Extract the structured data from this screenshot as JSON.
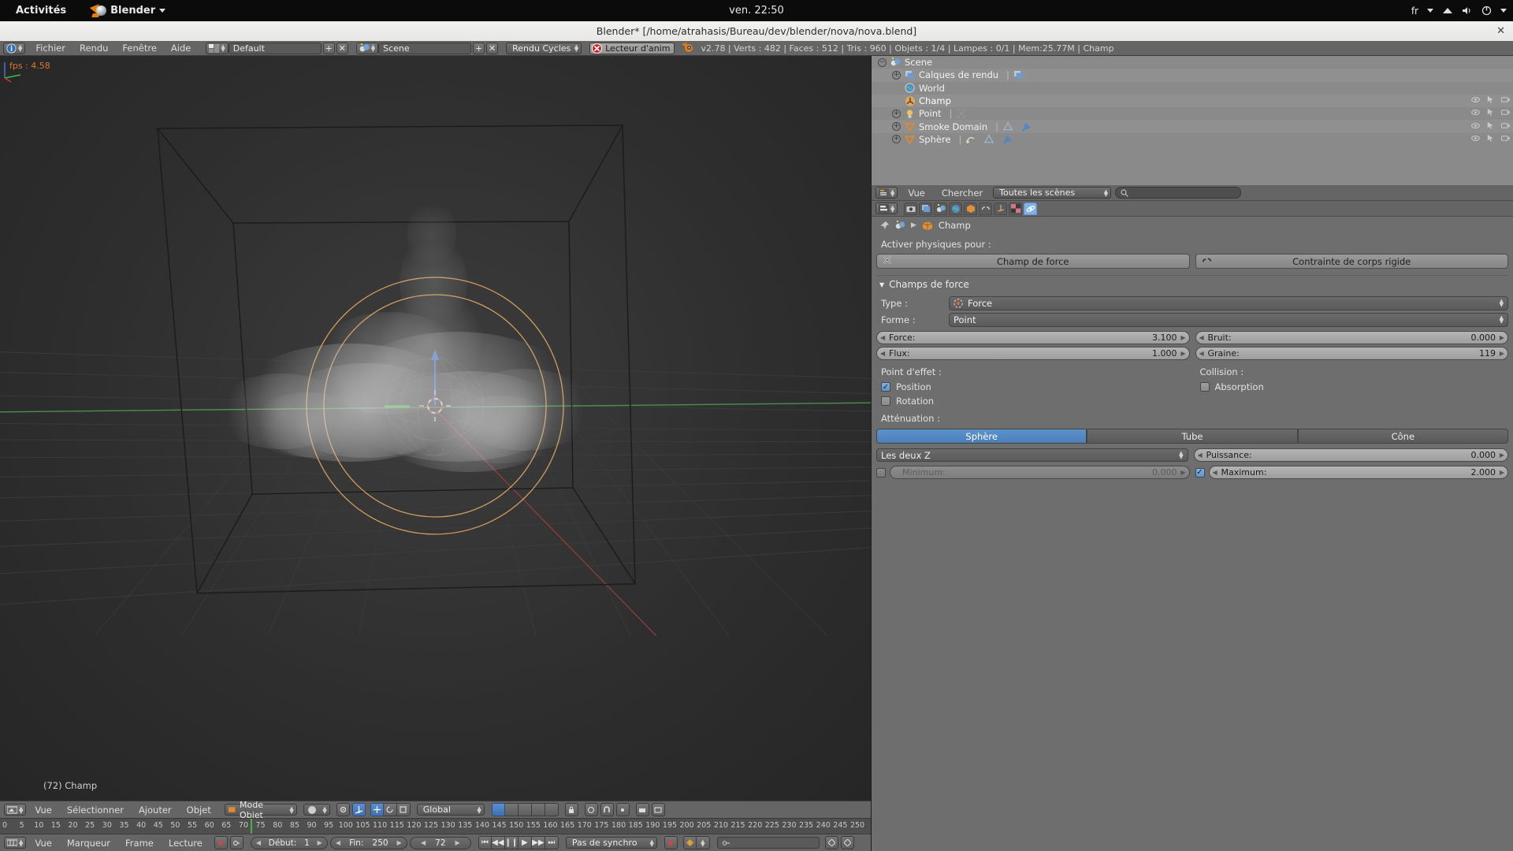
{
  "gnome": {
    "activities": "Activités",
    "app_name": "Blender",
    "clock": "ven. 22:50",
    "lang": "fr"
  },
  "window": {
    "title": "Blender* [/home/atrahasis/Bureau/dev/blender/nova/nova.blend]",
    "close": "✕"
  },
  "info_header": {
    "menus": [
      "Fichier",
      "Rendu",
      "Fenêtre",
      "Aide"
    ],
    "screen_layout": "Default",
    "scene": "Scene",
    "engine": "Rendu Cycles",
    "anim_player": "Lecteur d'anim",
    "stats": "v2.78 | Verts  : 482 | Faces  : 512 | Tris  : 960 | Objets  : 1/4 | Lampes  : 0/1 | Mem:25.77M | Champ",
    "add_label": "+",
    "remove_label": "✕"
  },
  "viewport": {
    "fps": "fps : 4.58",
    "object_label": "(72) Champ",
    "footer_menus": [
      "Vue",
      "Sélectionner",
      "Ajouter",
      "Objet"
    ],
    "mode": "Mode Objet",
    "orientation": "Global"
  },
  "timeline": {
    "menus": [
      "Vue",
      "Marqueur",
      "Frame",
      "Lecture"
    ],
    "start_label": "Début:",
    "start_value": "1",
    "end_label": "Fin:",
    "end_value": "250",
    "current_frame": "72",
    "sync_mode": "Pas de synchro",
    "ticks": [
      {
        "label": "0",
        "frame": 0
      },
      {
        "label": "5",
        "frame": 5
      },
      {
        "label": "10",
        "frame": 10
      },
      {
        "label": "15",
        "frame": 15
      },
      {
        "label": "20",
        "frame": 20
      },
      {
        "label": "25",
        "frame": 25
      },
      {
        "label": "30",
        "frame": 30
      },
      {
        "label": "35",
        "frame": 35
      },
      {
        "label": "40",
        "frame": 40
      },
      {
        "label": "45",
        "frame": 45
      },
      {
        "label": "50",
        "frame": 50
      },
      {
        "label": "55",
        "frame": 55
      },
      {
        "label": "60",
        "frame": 60
      },
      {
        "label": "65",
        "frame": 65
      },
      {
        "label": "70",
        "frame": 70
      },
      {
        "label": "75",
        "frame": 75
      },
      {
        "label": "80",
        "frame": 80
      },
      {
        "label": "85",
        "frame": 85
      },
      {
        "label": "90",
        "frame": 90
      },
      {
        "label": "95",
        "frame": 95
      },
      {
        "label": "100",
        "frame": 100
      },
      {
        "label": "105",
        "frame": 105
      },
      {
        "label": "110",
        "frame": 110
      },
      {
        "label": "115",
        "frame": 115
      },
      {
        "label": "120",
        "frame": 120
      },
      {
        "label": "125",
        "frame": 125
      },
      {
        "label": "130",
        "frame": 130
      },
      {
        "label": "135",
        "frame": 135
      },
      {
        "label": "140",
        "frame": 140
      },
      {
        "label": "145",
        "frame": 145
      },
      {
        "label": "150",
        "frame": 150
      },
      {
        "label": "155",
        "frame": 155
      },
      {
        "label": "160",
        "frame": 160
      },
      {
        "label": "165",
        "frame": 165
      },
      {
        "label": "170",
        "frame": 170
      },
      {
        "label": "175",
        "frame": 175
      },
      {
        "label": "180",
        "frame": 180
      },
      {
        "label": "185",
        "frame": 185
      },
      {
        "label": "190",
        "frame": 190
      },
      {
        "label": "195",
        "frame": 195
      },
      {
        "label": "200",
        "frame": 200
      },
      {
        "label": "205",
        "frame": 205
      },
      {
        "label": "210",
        "frame": 210
      },
      {
        "label": "215",
        "frame": 215
      },
      {
        "label": "220",
        "frame": 220
      },
      {
        "label": "225",
        "frame": 225
      },
      {
        "label": "230",
        "frame": 230
      },
      {
        "label": "235",
        "frame": 235
      },
      {
        "label": "240",
        "frame": 240
      },
      {
        "label": "245",
        "frame": 245
      },
      {
        "label": "250",
        "frame": 250
      }
    ]
  },
  "outliner": {
    "rows": [
      {
        "label": "Scene",
        "indent": 0,
        "expander": "−",
        "icon": "scene-icon"
      },
      {
        "label": "Calques de rendu",
        "indent": 1,
        "expander": "+",
        "icon": "renderlayers-icon"
      },
      {
        "label": "World",
        "indent": 1,
        "expander": "",
        "icon": "world-icon"
      },
      {
        "label": "Champ",
        "indent": 1,
        "expander": "",
        "icon": "force-field-icon",
        "selected": true
      },
      {
        "label": "Point",
        "indent": 1,
        "expander": "+",
        "icon": "lamp-icon"
      },
      {
        "label": "Smoke Domain",
        "indent": 1,
        "expander": "+",
        "icon": "mesh-icon"
      },
      {
        "label": "Sphère",
        "indent": 1,
        "expander": "+",
        "icon": "mesh-icon"
      }
    ],
    "header": {
      "view": "Vue",
      "search": "Chercher",
      "display_mode": "Toutes les scènes",
      "search_placeholder": ""
    }
  },
  "properties": {
    "breadcrumb_object": "Champ",
    "enable_physics_label": "Activer physiques pour  :",
    "force_field_button": "Champ de force",
    "rigid_body_button": "Contrainte de corps rigide",
    "panel_title": "Champs de force",
    "type_label": "Type  :",
    "type_value": "Force",
    "shape_label": "Forme  :",
    "shape_value": "Point",
    "strength_label": "Force:",
    "strength_value": "3.100",
    "noise_label": "Bruit:",
    "noise_value": "0.000",
    "flow_label": "Flux:",
    "flow_value": "1.000",
    "seed_label": "Graine:",
    "seed_value": "119",
    "effect_point_label": "Point d'effet  :",
    "collision_label": "Collision  :",
    "position_label": "Position",
    "rotation_label": "Rotation",
    "absorption_label": "Absorption",
    "falloff_label": "Atténuation  :",
    "falloff_tabs": [
      "Sphère",
      "Tube",
      "Cône"
    ],
    "falloff_selected": "Sphère",
    "z_mode": "Les deux Z",
    "power_label": "Puissance:",
    "power_value": "0.000",
    "min_label": "Minimum:",
    "min_value": "0.000",
    "max_label": "Maximum:",
    "max_value": "2.000"
  },
  "colors": {
    "accent_orange": "#e87d0d",
    "select_blue": "#5d93cc",
    "playhead_green": "#4ab04a",
    "header_gray": "#656565",
    "outliner_gray": "#8a8a8a"
  }
}
